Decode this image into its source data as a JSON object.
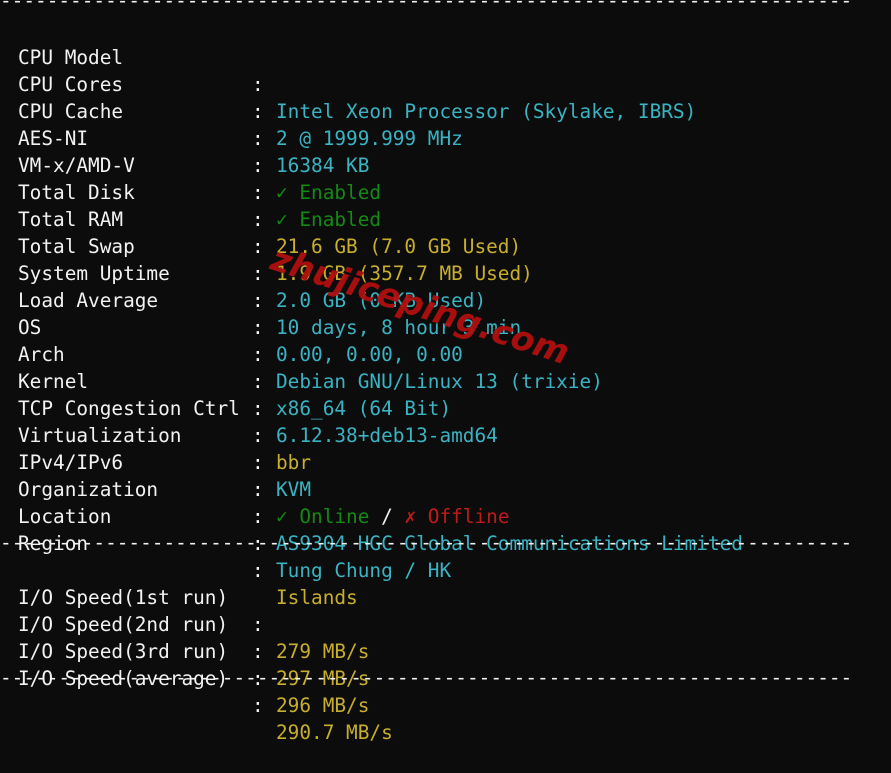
{
  "separators": {
    "top": "---------------------------------------------------------------------------------------",
    "middle": "---------------------------------------------------------------------------------------",
    "bottom": "---------------------------------------------------------------------------------------"
  },
  "system_info": [
    {
      "label": "CPU Model",
      "value": "Intel Xeon Processor (Skylake, IBRS)",
      "color": "cyan"
    },
    {
      "label": "CPU Cores",
      "value": "2 @ 1999.999 MHz",
      "color": "cyan"
    },
    {
      "label": "CPU Cache",
      "value": "16384 KB",
      "color": "cyan"
    },
    {
      "label": "AES-NI",
      "value": "✓ Enabled",
      "color": "green"
    },
    {
      "label": "VM-x/AMD-V",
      "value": "✓ Enabled",
      "color": "green"
    },
    {
      "label": "Total Disk",
      "value": "21.6 GB (7.0 GB Used)",
      "color": "yellow"
    },
    {
      "label": "Total RAM",
      "value": "1.9 GB (357.7 MB Used)",
      "color": "yellow"
    },
    {
      "label": "Total Swap",
      "value": "2.0 GB (0 KB Used)",
      "color": "cyan"
    },
    {
      "label": "System Uptime",
      "value": "10 days, 8 hour 3 min",
      "color": "cyan"
    },
    {
      "label": "Load Average",
      "value": "0.00, 0.00, 0.00",
      "color": "cyan"
    },
    {
      "label": "OS",
      "value": "Debian GNU/Linux 13 (trixie)",
      "color": "cyan"
    },
    {
      "label": "Arch",
      "value": "x86_64 (64 Bit)",
      "color": "cyan"
    },
    {
      "label": "Kernel",
      "value": "6.12.38+deb13-amd64",
      "color": "cyan"
    },
    {
      "label": "TCP Congestion Ctrl",
      "value": "bbr",
      "color": "yellow"
    },
    {
      "label": "Virtualization",
      "value": "KVM",
      "color": "cyan"
    },
    {
      "label": "IPv4/IPv6",
      "value_online": "✓ Online",
      "value_sep": " / ",
      "value_offline": "✗ Offline",
      "color": "mixed"
    },
    {
      "label": "Organization",
      "value": "AS9304 HGC Global Communications Limited",
      "color": "cyan"
    },
    {
      "label": "Location",
      "value": "Tung Chung / HK",
      "color": "cyan"
    },
    {
      "label": "Region",
      "value": "Islands",
      "color": "yellow"
    }
  ],
  "io_speed": [
    {
      "label": "I/O Speed(1st run)",
      "value": "279 MB/s"
    },
    {
      "label": "I/O Speed(2nd run)",
      "value": "297 MB/s"
    },
    {
      "label": "I/O Speed(3rd run)",
      "value": "296 MB/s"
    },
    {
      "label": "I/O Speed(average)",
      "value": "290.7 MB/s"
    }
  ],
  "colon": ":",
  "watermark": "zhujiceping.com",
  "colors": {
    "background": "#0c0c0c",
    "cyan": "#3ab3c2",
    "yellow": "#c7ae2d",
    "green": "#138a13",
    "red": "#c11a1a",
    "white": "#f2f2f2",
    "watermark": "#b01010"
  }
}
